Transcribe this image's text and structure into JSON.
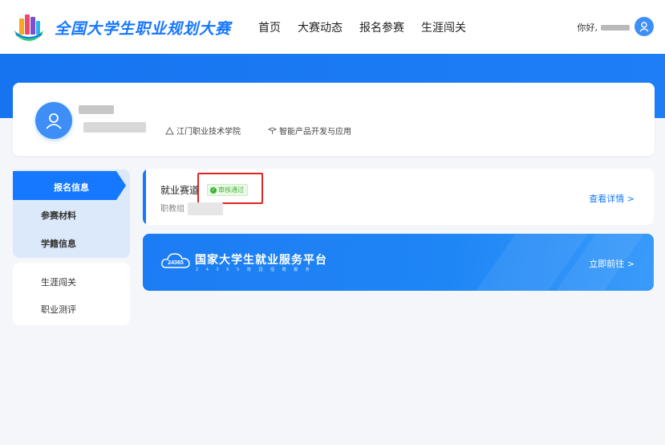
{
  "header": {
    "site_title": "全国大学生职业规划大赛",
    "nav": [
      "首页",
      "大赛动态",
      "报名参赛",
      "生涯闯关"
    ],
    "greeting": "你好,"
  },
  "profile": {
    "school_icon": "building-icon",
    "school": "江门职业技术学院",
    "major_icon": "graduation-cap-icon",
    "major": "智能产品开发与应用"
  },
  "sidebar": {
    "group1": [
      "报名信息",
      "参赛材料",
      "学籍信息"
    ],
    "group2": [
      "生涯闯关",
      "职业测评"
    ]
  },
  "track": {
    "title": "就业赛道",
    "status": "审核通过",
    "group": "职教组",
    "details_link": "查看详情 >"
  },
  "platform": {
    "logo_text": "24365",
    "name": "国家大学生就业服务平台",
    "sub": "2 4 3 6 5 校 园 招 聘 服 务",
    "link": "立即前往 >"
  },
  "colors": {
    "primary": "#1677ff",
    "banner": "#1674f0",
    "success": "#46b33d",
    "highlight": "#e02424"
  }
}
